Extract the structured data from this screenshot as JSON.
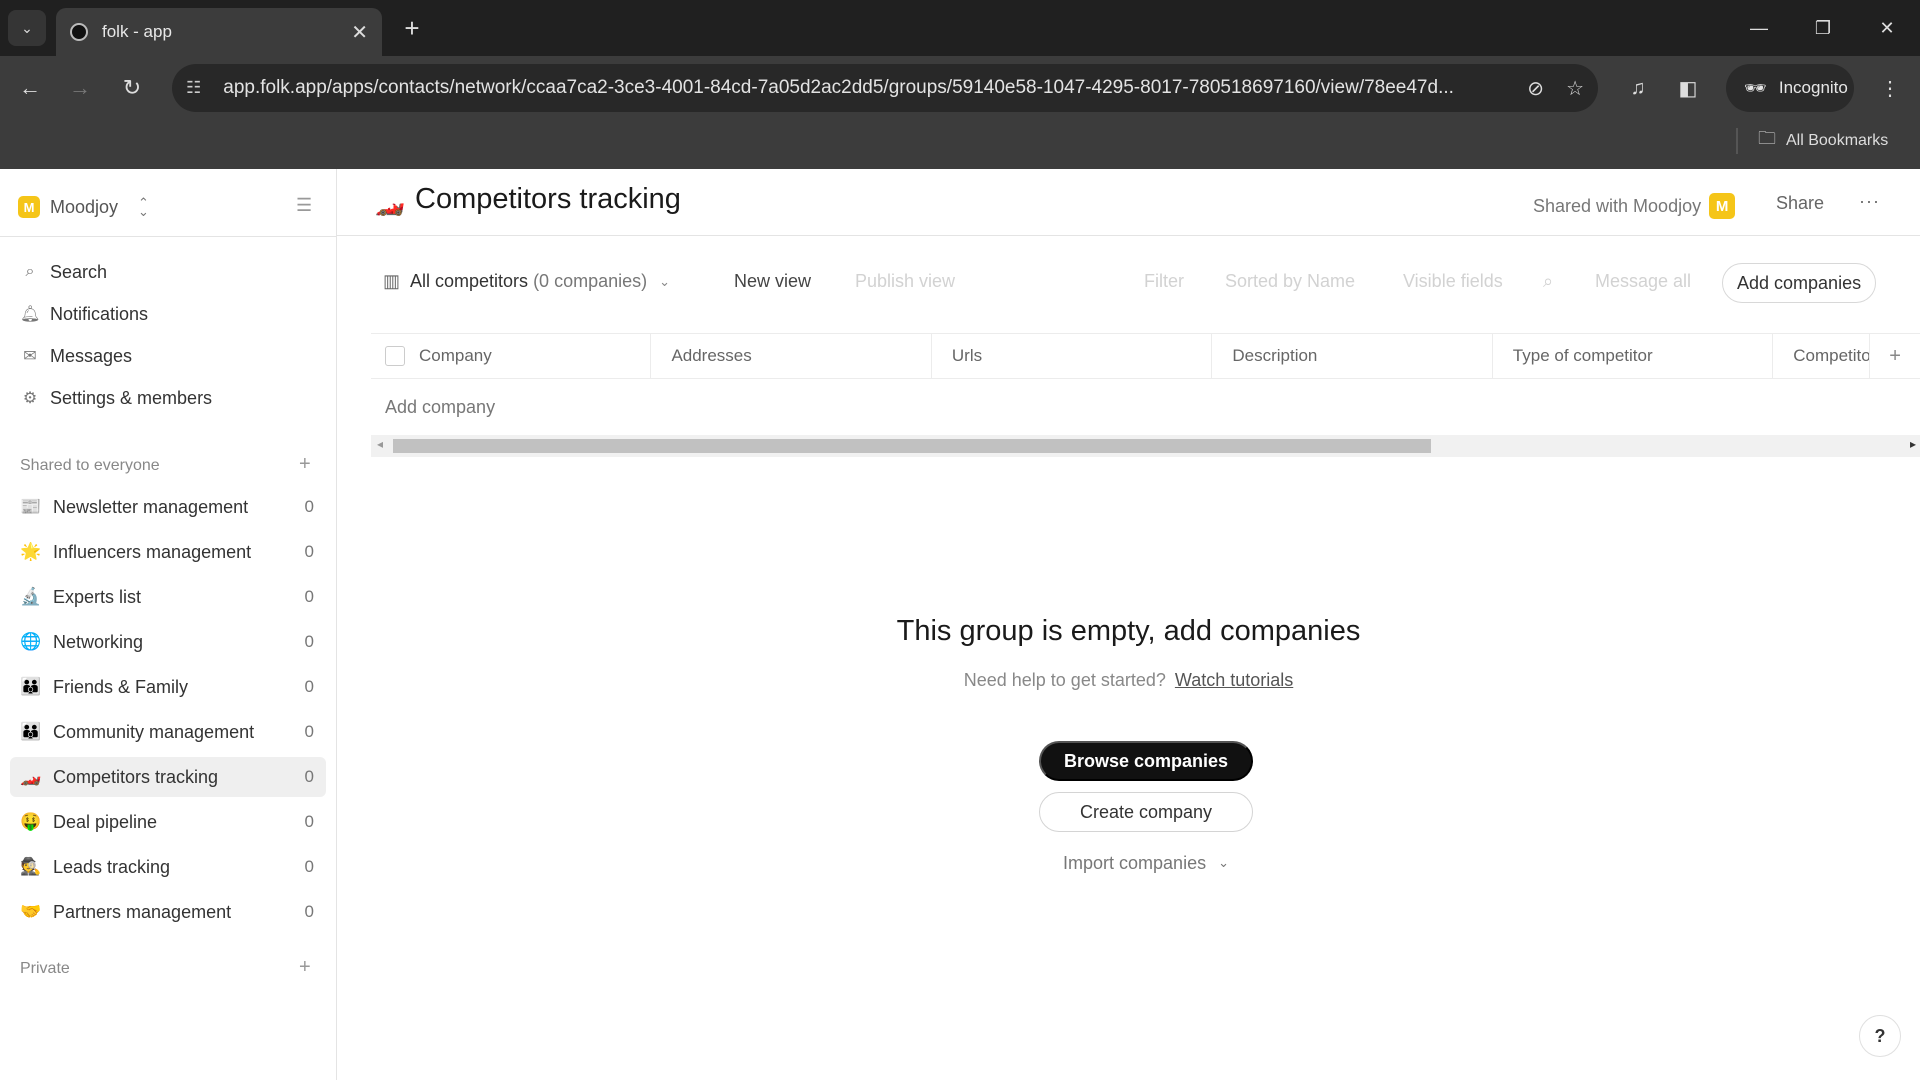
{
  "browser": {
    "tab_title": "folk - app",
    "url": "app.folk.app/apps/contacts/network/ccaa7ca2-3ce3-4001-84cd-7a05d2ac2dd5/groups/59140e58-1047-4295-8017-780518697160/view/78ee47d...",
    "incognito_label": "Incognito",
    "bookmarks_label": "All Bookmarks"
  },
  "sidebar": {
    "workspace_name": "Moodjoy",
    "workspace_initial": "M",
    "nav": [
      {
        "label": "Search",
        "icon": "search-icon"
      },
      {
        "label": "Notifications",
        "icon": "bell-icon"
      },
      {
        "label": "Messages",
        "icon": "mail-icon"
      },
      {
        "label": "Settings & members",
        "icon": "gear-icon"
      }
    ],
    "shared_section_label": "Shared to everyone",
    "groups": [
      {
        "label": "Newsletter management",
        "count": "0",
        "icon": "📰"
      },
      {
        "label": "Influencers management",
        "count": "0",
        "icon": "🌟"
      },
      {
        "label": "Experts list",
        "count": "0",
        "icon": "🔬"
      },
      {
        "label": "Networking",
        "count": "0",
        "icon": "🌐"
      },
      {
        "label": "Friends & Family",
        "count": "0",
        "icon": "👪"
      },
      {
        "label": "Community management",
        "count": "0",
        "icon": "👪"
      },
      {
        "label": "Competitors tracking",
        "count": "0",
        "icon": "🏎️",
        "active": true
      },
      {
        "label": "Deal pipeline",
        "count": "0",
        "icon": "🤑"
      },
      {
        "label": "Leads tracking",
        "count": "0",
        "icon": "🕵️"
      },
      {
        "label": "Partners management",
        "count": "0",
        "icon": "🤝"
      }
    ],
    "private_section_label": "Private"
  },
  "header": {
    "page_icon": "🏎️",
    "title": "Competitors tracking",
    "shared_with": "Shared with Moodjoy",
    "shared_badge": "M",
    "share_label": "Share",
    "more_label": "···"
  },
  "toolbar": {
    "view_name": "All competitors",
    "view_count": "(0 companies)",
    "new_view": "New view",
    "publish_view": "Publish view",
    "filter": "Filter",
    "sorted_by": "Sorted by Name",
    "visible_fields": "Visible fields",
    "message_all": "Message all",
    "add_companies": "Add companies"
  },
  "table": {
    "columns": [
      "Company",
      "Addresses",
      "Urls",
      "Description",
      "Type of competitor",
      "Competito"
    ],
    "add_row_label": "Add company"
  },
  "empty_state": {
    "title": "This group is empty, add companies",
    "help_text": "Need help to get started?",
    "help_link": "Watch tutorials",
    "browse_button": "Browse companies",
    "create_button": "Create company",
    "import_button": "Import companies"
  },
  "help_button": "?",
  "colors": {
    "brand_yellow": "#f5c518",
    "primary_button": "#111111"
  }
}
